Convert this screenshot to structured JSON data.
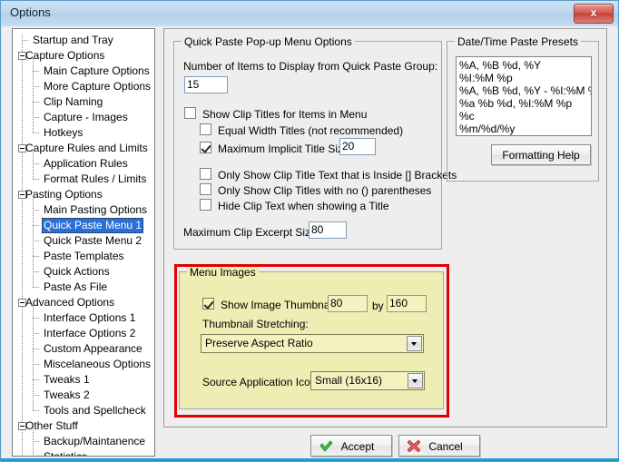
{
  "window": {
    "title": "Options",
    "close_label": "x"
  },
  "tree": {
    "nodes": [
      {
        "label": "Startup and Tray",
        "level": 1,
        "expander": false,
        "selected": false
      },
      {
        "label": "Capture Options",
        "level": 0,
        "expander": true,
        "selected": false
      },
      {
        "label": "Main Capture Options",
        "level": 2,
        "expander": false,
        "selected": false
      },
      {
        "label": "More Capture Options",
        "level": 2,
        "expander": false,
        "selected": false
      },
      {
        "label": "Clip Naming",
        "level": 2,
        "expander": false,
        "selected": false
      },
      {
        "label": "Capture - Images",
        "level": 2,
        "expander": false,
        "selected": false
      },
      {
        "label": "Hotkeys",
        "level": 2,
        "expander": false,
        "selected": false
      },
      {
        "label": "Capture Rules and Limits",
        "level": 0,
        "expander": true,
        "selected": false
      },
      {
        "label": "Application Rules",
        "level": 2,
        "expander": false,
        "selected": false
      },
      {
        "label": "Format Rules / Limits",
        "level": 2,
        "expander": false,
        "selected": false
      },
      {
        "label": "Pasting Options",
        "level": 0,
        "expander": true,
        "selected": false
      },
      {
        "label": "Main Pasting Options",
        "level": 2,
        "expander": false,
        "selected": false
      },
      {
        "label": "Quick Paste Menu 1",
        "level": 2,
        "expander": false,
        "selected": true
      },
      {
        "label": "Quick Paste Menu 2",
        "level": 2,
        "expander": false,
        "selected": false
      },
      {
        "label": "Paste Templates",
        "level": 2,
        "expander": false,
        "selected": false
      },
      {
        "label": "Quick Actions",
        "level": 2,
        "expander": false,
        "selected": false
      },
      {
        "label": "Paste As File",
        "level": 2,
        "expander": false,
        "selected": false
      },
      {
        "label": "Advanced Options",
        "level": 0,
        "expander": true,
        "selected": false
      },
      {
        "label": "Interface Options 1",
        "level": 2,
        "expander": false,
        "selected": false
      },
      {
        "label": "Interface Options 2",
        "level": 2,
        "expander": false,
        "selected": false
      },
      {
        "label": "Custom Appearance",
        "level": 2,
        "expander": false,
        "selected": false
      },
      {
        "label": "Miscelaneous Options",
        "level": 2,
        "expander": false,
        "selected": false
      },
      {
        "label": "Tweaks 1",
        "level": 2,
        "expander": false,
        "selected": false
      },
      {
        "label": "Tweaks 2",
        "level": 2,
        "expander": false,
        "selected": false
      },
      {
        "label": "Tools and Spellcheck",
        "level": 2,
        "expander": false,
        "selected": false
      },
      {
        "label": "Other Stuff",
        "level": 0,
        "expander": true,
        "selected": false
      },
      {
        "label": "Backup/Maintanence",
        "level": 2,
        "expander": false,
        "selected": false
      },
      {
        "label": "Statistics",
        "level": 2,
        "expander": false,
        "selected": false
      }
    ]
  },
  "quick_paste_group": {
    "title": "Quick Paste Pop-up Menu Options",
    "number_items_label": "Number of Items to Display from Quick Paste Group:",
    "number_items_value": "15",
    "show_clip_titles_label": "Show Clip Titles for Items in Menu",
    "show_clip_titles_checked": false,
    "equal_width_label": "Equal Width Titles (not recommended)",
    "equal_width_checked": false,
    "max_implicit_label": "Maximum Implicit Title Size:",
    "max_implicit_checked": true,
    "max_implicit_value": "20",
    "only_brackets_label": "Only Show Clip Title Text that is Inside [] Brackets",
    "only_brackets_checked": false,
    "only_no_parens_label": "Only Show Clip Titles with no () parentheses",
    "only_no_parens_checked": false,
    "hide_clip_text_label": "Hide Clip Text when showing a Title",
    "hide_clip_text_checked": false,
    "max_excerpt_label": "Maximum Clip Excerpt Size:",
    "max_excerpt_value": "80"
  },
  "menu_images_group": {
    "title": "Menu Images",
    "show_thumbnails_label": "Show Image Thumbnails:",
    "show_thumbnails_checked": true,
    "thumb_width": "80",
    "by_label": "by",
    "thumb_height": "160",
    "stretching_label": "Thumbnail Stretching:",
    "stretching_value": "Preserve Aspect Ratio",
    "source_icons_label": "Source Application Icons:",
    "source_icons_value": "Small (16x16)",
    "highlight_color": "#e00000"
  },
  "datetime_group": {
    "title": "Date/Time Paste Presets",
    "presets_text": "%A, %B %d, %Y\n%I:%M %p\n%A, %B %d, %Y - %I:%M %p\n%a %b %d, %I:%M %p\n%c\n%m/%d/%y",
    "formatting_help_label": "Formatting Help"
  },
  "footer": {
    "accept_label": "Accept",
    "cancel_label": "Cancel"
  }
}
